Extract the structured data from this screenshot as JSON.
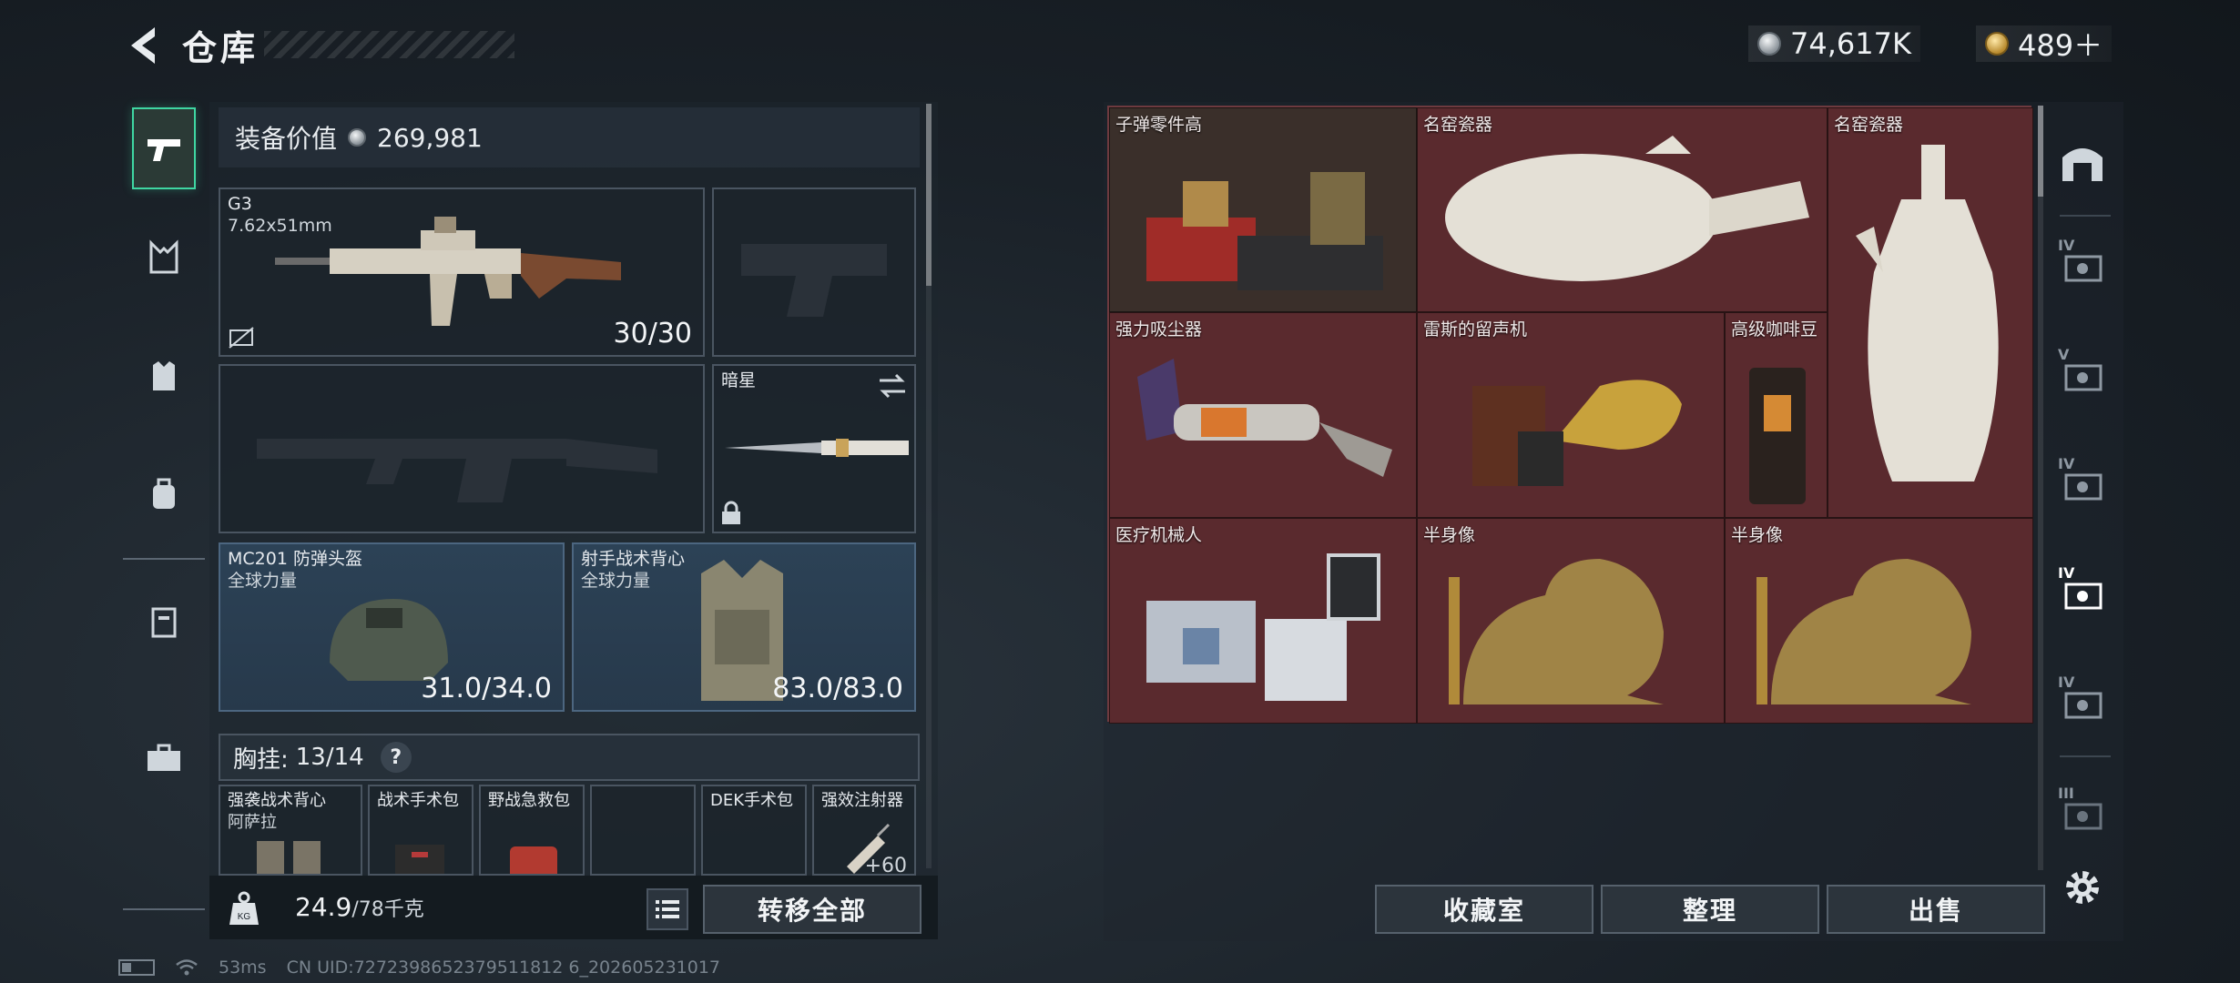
{
  "header": {
    "title": "仓库"
  },
  "currency": {
    "silver": "74,617K",
    "gold": "489＋"
  },
  "equipment": {
    "value_label": "装备价值",
    "value": "269,981",
    "primary": {
      "name": "G3",
      "caliber": "7.62x51mm",
      "ammo": "30/30"
    },
    "melee": {
      "name": "暗星"
    },
    "helmet": {
      "name": "MC201 防弹头盔",
      "sub": "全球力量",
      "durability": "31.0/34.0"
    },
    "armor": {
      "name": "射手战术背心",
      "sub": "全球力量",
      "durability": "83.0/83.0"
    },
    "vest": {
      "label": "胸挂:",
      "capacity": "13/14",
      "help": "?"
    },
    "vest_items": [
      {
        "name": "强袭战术背心",
        "sub": "阿萨拉"
      },
      {
        "name": "战术手术包",
        "sub": ""
      },
      {
        "name": "野战急救包",
        "sub": ""
      },
      {
        "name": "",
        "sub": ""
      },
      {
        "name": "DEK手术包",
        "sub": ""
      },
      {
        "name": "强效注射器",
        "sub": "",
        "count": "+60"
      }
    ]
  },
  "weight": {
    "current": "24.9",
    "max": "/78千克"
  },
  "buttons": {
    "transfer_all": "转移全部",
    "collection": "收藏室",
    "sort": "整理",
    "sell": "出售"
  },
  "storage_items": [
    {
      "name": "子弹零件高"
    },
    {
      "name": "名窑瓷器"
    },
    {
      "name": "名窑瓷器"
    },
    {
      "name": "强力吸尘器"
    },
    {
      "name": "雷斯的留声机"
    },
    {
      "name": "高级咖啡豆"
    },
    {
      "name": "医疗机械人"
    },
    {
      "name": "半身像"
    },
    {
      "name": "半身像"
    }
  ],
  "right_rail": {
    "levels": [
      "IV",
      "V",
      "IV",
      "IV",
      "IV",
      "III"
    ]
  },
  "footer": {
    "ping": "53ms",
    "uid": "CN UID:7272398652379511812 6_202605231017"
  }
}
